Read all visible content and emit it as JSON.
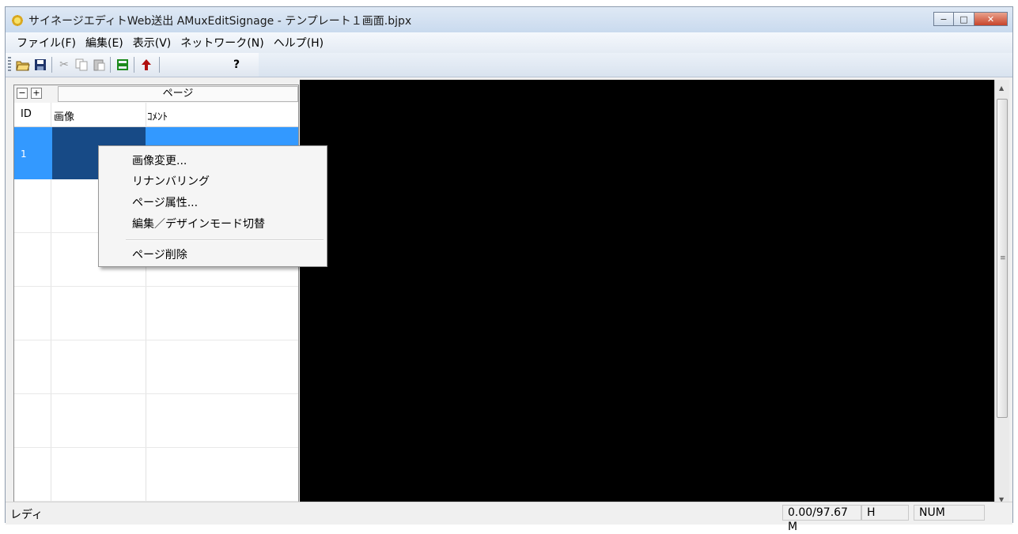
{
  "window": {
    "title": "サイネージエディトWeb送出 AMuxEditSignage - テンプレート１画面.bjpx"
  },
  "caption_buttons": {
    "minimize": "−",
    "maximize": "□",
    "close": "✕"
  },
  "menubar": {
    "items": [
      "ファイル(F)",
      "編集(E)",
      "表示(V)",
      "ネットワーク(N)",
      "ヘルプ(H)"
    ]
  },
  "toolbar": {
    "icons": [
      "open-icon",
      "save-icon",
      "cut-icon",
      "copy-icon",
      "paste-icon",
      "send-icon",
      "upload-icon",
      "help-icon"
    ],
    "accent_green": "#1c8a1c",
    "accent_red": "#b01010"
  },
  "page_panel": {
    "collapse": "−",
    "expand": "+",
    "title": "ページ",
    "columns": [
      "ID",
      "画像",
      "ｺﾒﾝﾄ"
    ],
    "rows": [
      {
        "id": "1",
        "comment": ""
      }
    ],
    "selection_color": "#3399ff"
  },
  "context_menu": {
    "items": [
      "画像変更...",
      "リナンバリング",
      "ページ属性...",
      "編集／デザインモード切替",
      "ページ削除"
    ]
  },
  "statusbar": {
    "ready": "レディ",
    "size": "0.00/97.67 M",
    "h": "H",
    "num": "NUM"
  }
}
